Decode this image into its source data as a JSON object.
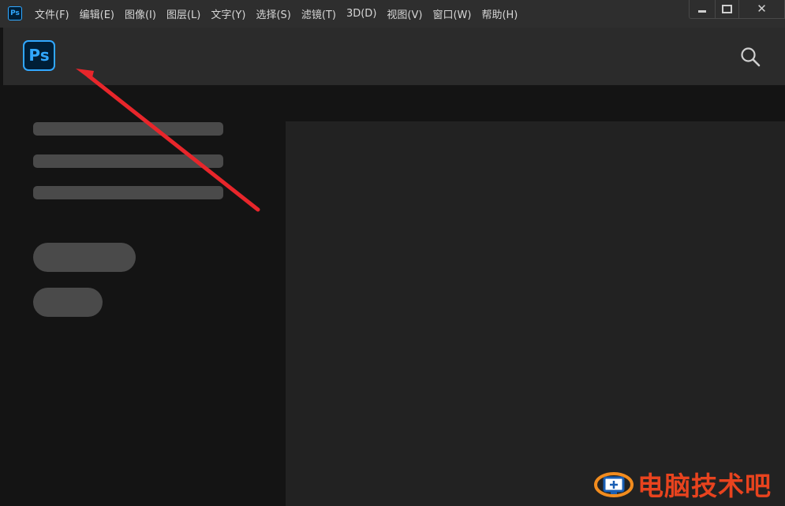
{
  "app": {
    "icon_label": "Ps"
  },
  "menu": {
    "items": [
      {
        "label": "文件(F)"
      },
      {
        "label": "编辑(E)"
      },
      {
        "label": "图像(I)"
      },
      {
        "label": "图层(L)"
      },
      {
        "label": "文字(Y)"
      },
      {
        "label": "选择(S)"
      },
      {
        "label": "滤镜(T)"
      },
      {
        "label": "3D(D)"
      },
      {
        "label": "视图(V)"
      },
      {
        "label": "窗口(W)"
      },
      {
        "label": "帮助(H)"
      }
    ]
  },
  "window_controls": {
    "close_glyph": "✕"
  },
  "header": {
    "logo_text": "Ps",
    "search_icon": "search-icon"
  },
  "watermark": {
    "text": "电脑技术吧"
  },
  "colors": {
    "accent": "#31a8ff",
    "logo_bg": "#001e36",
    "arrow": "#e8262b",
    "watermark": "#e8431e"
  }
}
